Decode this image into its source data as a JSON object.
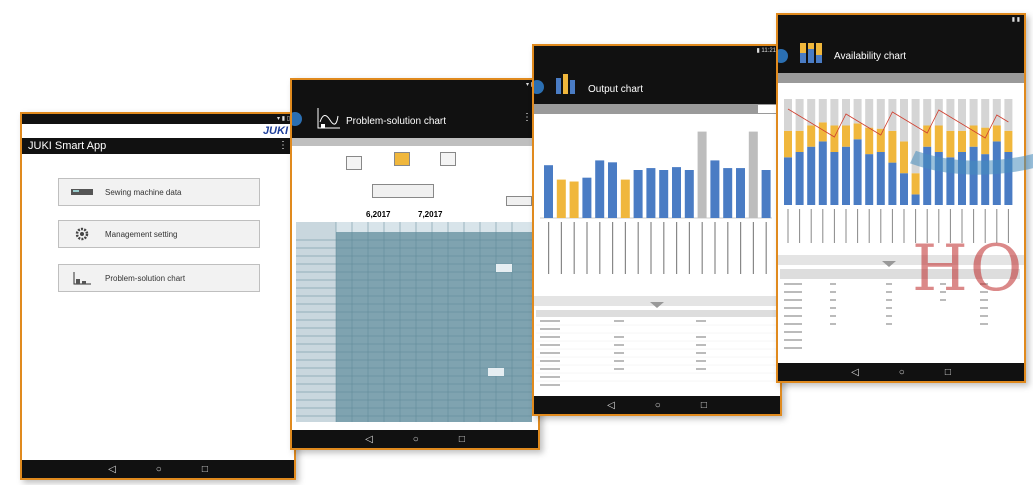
{
  "brand": {
    "logo": "JUKI"
  },
  "screen1": {
    "title": "JUKI Smart App",
    "menu_icon": "⋮",
    "buttons": [
      {
        "label": "Sewing machine data",
        "icon": "sewing-machine-icon"
      },
      {
        "label": "Management setting",
        "icon": "gear-icon"
      },
      {
        "label": "Problem-solution chart",
        "icon": "chart-icon"
      }
    ]
  },
  "screen2": {
    "title": "Problem-solution chart",
    "months": [
      "6,2017",
      "7,2017"
    ]
  },
  "screen3": {
    "title": "Output chart",
    "bars": [
      0.55,
      0.4,
      0.38,
      0.42,
      0.6,
      0.58,
      0.4,
      0.5,
      0.52,
      0.5,
      0.53,
      0.5,
      0.9,
      0.6,
      0.52,
      0.52,
      0.9,
      0.5
    ],
    "bar_kinds": [
      "b",
      "o",
      "o",
      "b",
      "b",
      "b",
      "o",
      "b",
      "b",
      "b",
      "b",
      "b",
      "g",
      "b",
      "b",
      "b",
      "g",
      "b"
    ]
  },
  "screen4": {
    "title": "Availability chart"
  },
  "colors": {
    "accent": "#e08a1e",
    "blue": "#4a7cc4",
    "orange": "#f0b73c",
    "gray": "#bdbdbd"
  },
  "watermark": {
    "text": "HO"
  }
}
